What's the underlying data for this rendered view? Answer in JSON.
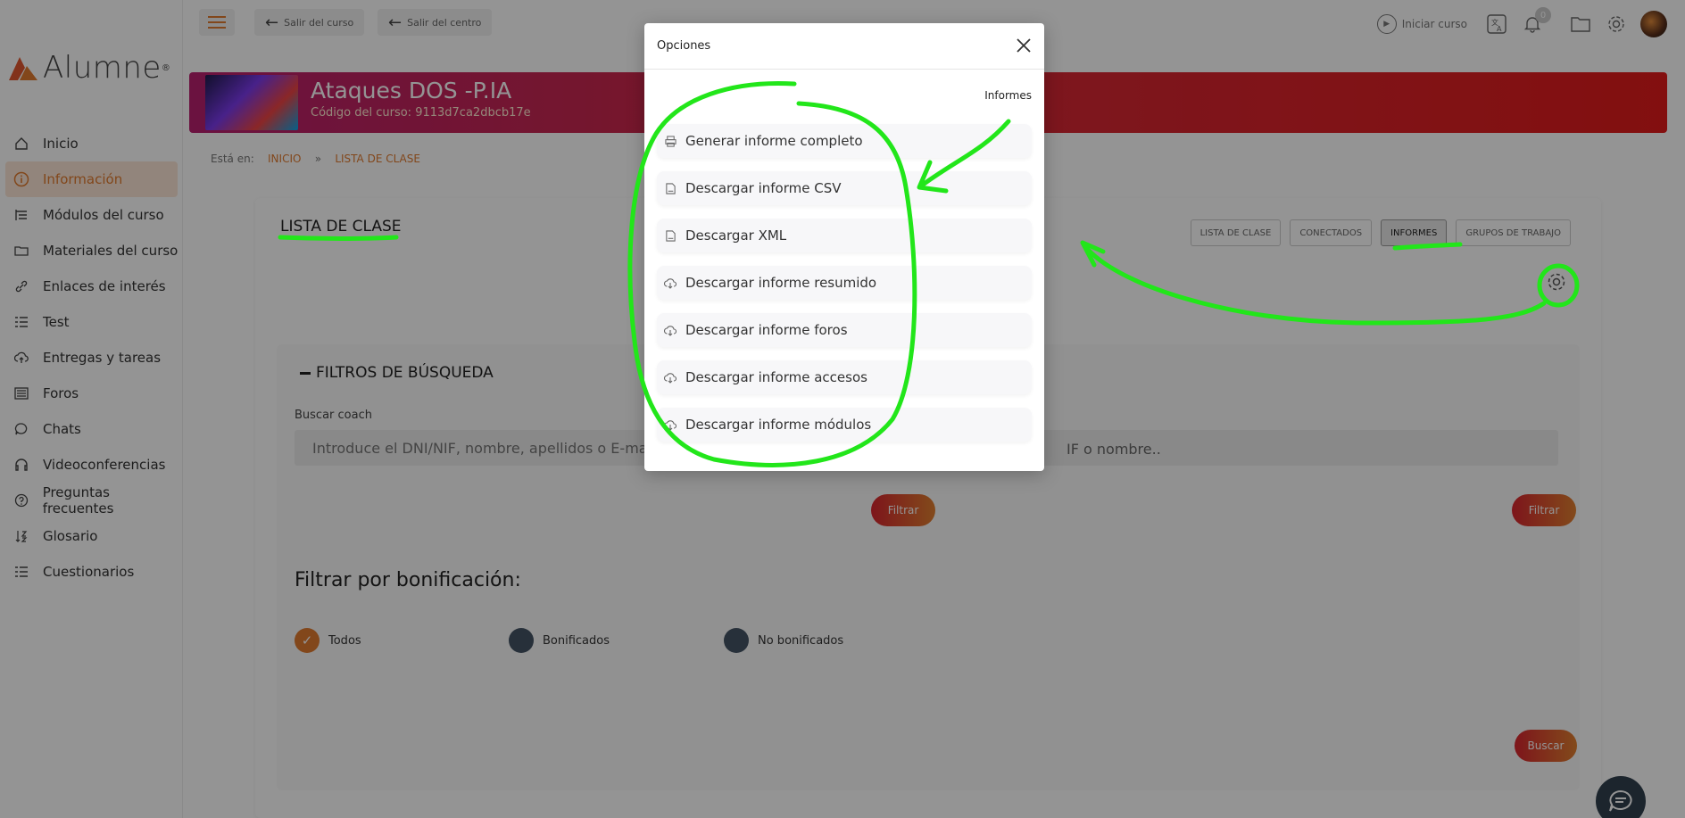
{
  "brand": {
    "logo_text": "Alumne",
    "reg": "®"
  },
  "sidebar": {
    "items": [
      {
        "label": "Inicio",
        "icon": "home-icon"
      },
      {
        "label": "Información",
        "icon": "info-icon",
        "active": true
      },
      {
        "label": "Módulos del curso",
        "icon": "modules-icon"
      },
      {
        "label": "Materiales del curso",
        "icon": "folder-icon"
      },
      {
        "label": "Enlaces de interés",
        "icon": "link-icon"
      },
      {
        "label": "Test",
        "icon": "test-icon"
      },
      {
        "label": "Entregas y tareas",
        "icon": "upload-icon"
      },
      {
        "label": "Foros",
        "icon": "forum-icon"
      },
      {
        "label": "Chats",
        "icon": "chat-icon"
      },
      {
        "label": "Videoconferencias",
        "icon": "headset-icon"
      },
      {
        "label": "Preguntas frecuentes",
        "icon": "question-icon"
      },
      {
        "label": "Glosario",
        "icon": "sort-icon"
      },
      {
        "label": "Cuestionarios",
        "icon": "list-icon"
      }
    ]
  },
  "topbar": {
    "exit_course": "Salir del curso",
    "exit_center": "Salir del centro",
    "start_course": "Iniciar curso",
    "notifications_count": "0"
  },
  "course": {
    "title": "Ataques DOS -P.IA",
    "code": "Código del curso: 9113d7ca2dbcb17e"
  },
  "breadcrumb": {
    "prefix": "Está en:",
    "home": "INICIO",
    "sep": "»",
    "current": "LISTA DE CLASE"
  },
  "main": {
    "title": "LISTA DE CLASE",
    "tabs": [
      "LISTA DE CLASE",
      "CONECTADOS",
      "INFORMES",
      "GRUPOS DE TRABAJO"
    ],
    "active_tab": "INFORMES",
    "filters": {
      "title": "FILTROS DE BÚSQUEDA",
      "search_label": "Buscar coach",
      "search_placeholder": "Introduce el DNI/NIF, nombre, apellidos o E-mail...",
      "search2_text": "IF o nombre..",
      "filter_button": "Filtrar",
      "filter_button2": "Filtrar",
      "bonus_title": "Filtrar por bonificación:",
      "options": [
        "Todos",
        "Bonificados",
        "No bonificados"
      ],
      "selected": "Todos",
      "search_button": "Buscar"
    }
  },
  "modal": {
    "title": "Opciones",
    "section": "Informes",
    "items": [
      {
        "label": "Generar informe completo",
        "icon": "printer-icon"
      },
      {
        "label": "Descargar informe CSV",
        "icon": "file-icon"
      },
      {
        "label": "Descargar XML",
        "icon": "file-icon"
      },
      {
        "label": "Descargar informe resumido",
        "icon": "cloud-download-icon"
      },
      {
        "label": "Descargar informe foros",
        "icon": "cloud-download-icon"
      },
      {
        "label": "Descargar informe accesos",
        "icon": "cloud-download-icon"
      },
      {
        "label": "Descargar informe módulos",
        "icon": "cloud-download-icon"
      }
    ]
  },
  "colors": {
    "accent": "#e07a2f",
    "brand_red": "#d9252f",
    "annotation": "#22e61a"
  }
}
